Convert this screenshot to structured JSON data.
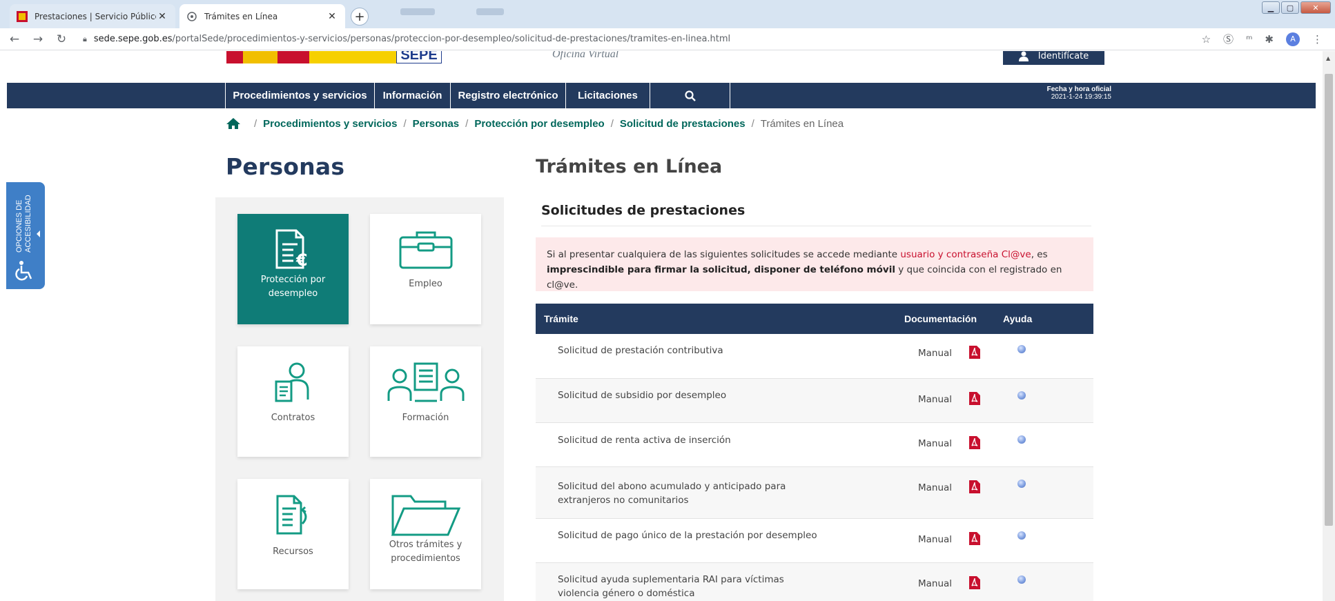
{
  "browser": {
    "tabs": [
      {
        "title": "Prestaciones | Servicio Público de",
        "active": false
      },
      {
        "title": "Trámites en Línea",
        "active": true
      }
    ],
    "new_tab_label": "+",
    "url_host": "sede.sepe.gob.es",
    "url_path": "/portalSede/procedimientos-y-servicios/personas/proteccion-por-desempleo/solicitud-de-prestaciones/tramites-en-linea.html",
    "avatar_letter": "A"
  },
  "header": {
    "oficina": "Oficina Virtual",
    "sepe": "SEPE",
    "identificate": "Identifícate"
  },
  "nav": {
    "items": [
      "Procedimientos y servicios",
      "Información",
      "Registro electrónico",
      "Licitaciones"
    ],
    "fecha_label": "Fecha y hora oficial",
    "fecha_value": "2021-1-24   19:39:15"
  },
  "breadcrumb": {
    "links": [
      "Procedimientos y servicios",
      "Personas",
      "Protección por desempleo",
      "Solicitud de prestaciones"
    ],
    "current": "Trámites en Línea"
  },
  "accessibility": {
    "label1": "OPCIONES DE",
    "label2": "ACCESIBILIDAD"
  },
  "left": {
    "title": "Personas",
    "tiles": [
      {
        "label": "Protección por desempleo",
        "icon": "document-euro-icon"
      },
      {
        "label": "Empleo",
        "icon": "briefcase-icon"
      },
      {
        "label": "Contratos",
        "icon": "contract-person-icon"
      },
      {
        "label": "Formación",
        "icon": "training-group-icon"
      },
      {
        "label": "Recursos",
        "icon": "document-arrow-icon"
      },
      {
        "label": "Otros trámites y procedimientos",
        "icon": "folder-icon"
      }
    ]
  },
  "main": {
    "title": "Trámites en Línea",
    "section": "Solicitudes de prestaciones",
    "notice": {
      "t1": "Si al presentar cualquiera de las siguientes solicitudes se accede mediante ",
      "link": "usuario y contraseña Cl@ve",
      "t2": ", es ",
      "bold": "imprescindible para firmar la solicitud, disponer de teléfono móvil",
      "t3": " y que coincida con el registrado en cl@ve."
    },
    "table": {
      "headers": {
        "tramite": "Trámite",
        "documentacion": "Documentación",
        "ayuda": "Ayuda"
      },
      "rows": [
        {
          "name": "Solicitud de prestación contributiva",
          "doc": "Manual"
        },
        {
          "name": "Solicitud de subsidio por desempleo",
          "doc": "Manual"
        },
        {
          "name": "Solicitud de renta activa de inserción",
          "doc": "Manual"
        },
        {
          "name": "Solicitud del abono acumulado y anticipado para extranjeros no comunitarios",
          "doc": "Manual"
        },
        {
          "name": "Solicitud de pago único de la prestación por desempleo",
          "doc": "Manual"
        },
        {
          "name": "Solicitud ayuda suplementaria RAI para víctimas violencia género o doméstica",
          "doc": "Manual"
        }
      ]
    }
  },
  "colors": {
    "navy": "#233a5e",
    "teal": "#0f7c77",
    "accent_red": "#c8102e",
    "breadcrumb_green": "#00675b"
  }
}
